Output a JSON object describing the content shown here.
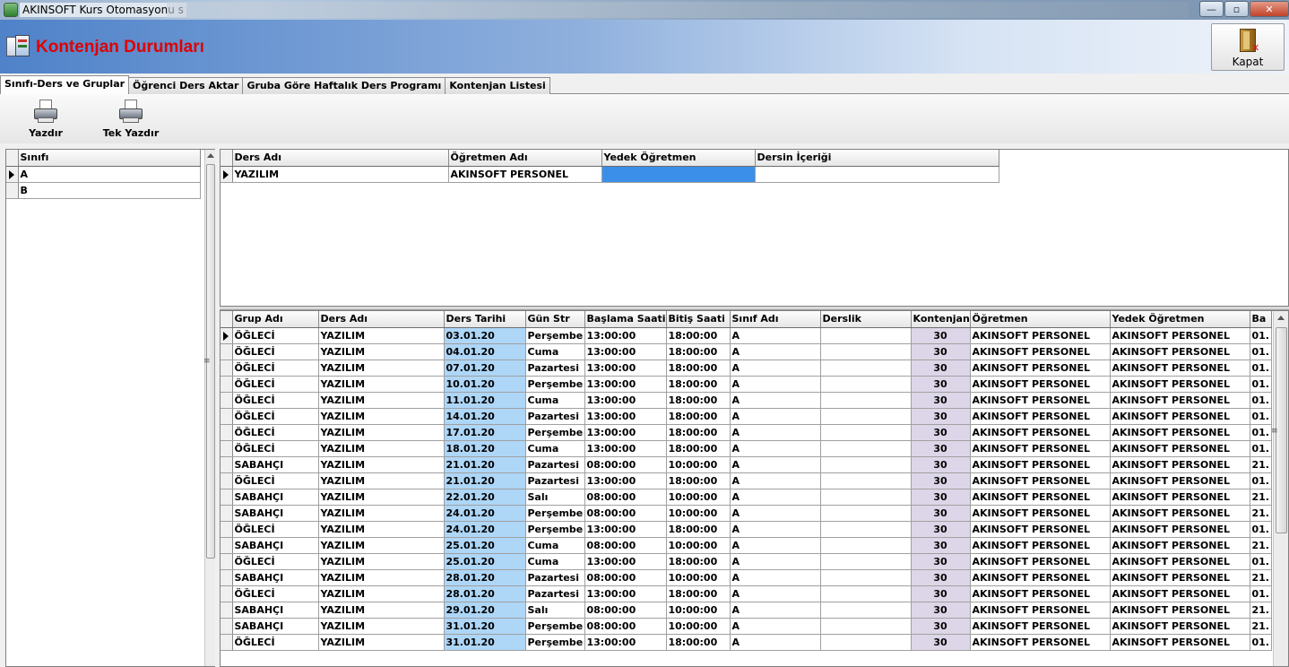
{
  "window": {
    "title": "AKINSOFT Kurs Otomasyonu s",
    "buttons": {
      "minimize": "—",
      "maximize": "▫",
      "close": "✕"
    }
  },
  "header": {
    "title": "Kontenjan Durumları",
    "close_label": "Kapat"
  },
  "tabs": [
    {
      "label": "Sınıfı-Ders ve Gruplar",
      "active": true
    },
    {
      "label": "Öğrenci Ders Aktar",
      "active": false
    },
    {
      "label": "Gruba Göre Haftalık Ders Programı",
      "active": false
    },
    {
      "label": "Kontenjan Listesi",
      "active": false
    }
  ],
  "toolbar": {
    "print_label": "Yazdır",
    "single_print_label": "Tek Yazdır"
  },
  "class_grid": {
    "header": "Sınıfı",
    "rows": [
      "A",
      "B"
    ]
  },
  "course_grid": {
    "headers": [
      "Ders Adı",
      "Öğretmen Adı",
      "Yedek Öğretmen",
      "Dersin İçeriği"
    ],
    "rows": [
      {
        "ders": "YAZILIM",
        "ogretmen": "AKINSOFT PERSONEL",
        "yedek": "",
        "icerik": ""
      }
    ]
  },
  "schedule_grid": {
    "headers": [
      "Grup Adı",
      "Ders Adı",
      "Ders Tarihi",
      "Gün Str",
      "Başlama Saati",
      "Bitiş Saati",
      "Sınıf Adı",
      "Derslik",
      "Kontenjan",
      "Öğretmen",
      "Yedek Öğretmen",
      "Ba"
    ],
    "rows": [
      [
        "ÖĞLECİ",
        "YAZILIM",
        "03.01.20",
        "Perşembe",
        "13:00:00",
        "18:00:00",
        "A",
        "",
        "30",
        "AKINSOFT PERSONEL",
        "AKINSOFT PERSONEL",
        "01."
      ],
      [
        "ÖĞLECİ",
        "YAZILIM",
        "04.01.20",
        "Cuma",
        "13:00:00",
        "18:00:00",
        "A",
        "",
        "30",
        "AKINSOFT PERSONEL",
        "AKINSOFT PERSONEL",
        "01."
      ],
      [
        "ÖĞLECİ",
        "YAZILIM",
        "07.01.20",
        "Pazartesi",
        "13:00:00",
        "18:00:00",
        "A",
        "",
        "30",
        "AKINSOFT PERSONEL",
        "AKINSOFT PERSONEL",
        "01."
      ],
      [
        "ÖĞLECİ",
        "YAZILIM",
        "10.01.20",
        "Perşembe",
        "13:00:00",
        "18:00:00",
        "A",
        "",
        "30",
        "AKINSOFT PERSONEL",
        "AKINSOFT PERSONEL",
        "01."
      ],
      [
        "ÖĞLECİ",
        "YAZILIM",
        "11.01.20",
        "Cuma",
        "13:00:00",
        "18:00:00",
        "A",
        "",
        "30",
        "AKINSOFT PERSONEL",
        "AKINSOFT PERSONEL",
        "01."
      ],
      [
        "ÖĞLECİ",
        "YAZILIM",
        "14.01.20",
        "Pazartesi",
        "13:00:00",
        "18:00:00",
        "A",
        "",
        "30",
        "AKINSOFT PERSONEL",
        "AKINSOFT PERSONEL",
        "01."
      ],
      [
        "ÖĞLECİ",
        "YAZILIM",
        "17.01.20",
        "Perşembe",
        "13:00:00",
        "18:00:00",
        "A",
        "",
        "30",
        "AKINSOFT PERSONEL",
        "AKINSOFT PERSONEL",
        "01."
      ],
      [
        "ÖĞLECİ",
        "YAZILIM",
        "18.01.20",
        "Cuma",
        "13:00:00",
        "18:00:00",
        "A",
        "",
        "30",
        "AKINSOFT PERSONEL",
        "AKINSOFT PERSONEL",
        "01."
      ],
      [
        "SABAHÇI",
        "YAZILIM",
        "21.01.20",
        "Pazartesi",
        "08:00:00",
        "10:00:00",
        "A",
        "",
        "30",
        "AKINSOFT PERSONEL",
        "AKINSOFT PERSONEL",
        "21."
      ],
      [
        "ÖĞLECİ",
        "YAZILIM",
        "21.01.20",
        "Pazartesi",
        "13:00:00",
        "18:00:00",
        "A",
        "",
        "30",
        "AKINSOFT PERSONEL",
        "AKINSOFT PERSONEL",
        "01."
      ],
      [
        "SABAHÇI",
        "YAZILIM",
        "22.01.20",
        "Salı",
        "08:00:00",
        "10:00:00",
        "A",
        "",
        "30",
        "AKINSOFT PERSONEL",
        "AKINSOFT PERSONEL",
        "21."
      ],
      [
        "SABAHÇI",
        "YAZILIM",
        "24.01.20",
        "Perşembe",
        "08:00:00",
        "10:00:00",
        "A",
        "",
        "30",
        "AKINSOFT PERSONEL",
        "AKINSOFT PERSONEL",
        "21."
      ],
      [
        "ÖĞLECİ",
        "YAZILIM",
        "24.01.20",
        "Perşembe",
        "13:00:00",
        "18:00:00",
        "A",
        "",
        "30",
        "AKINSOFT PERSONEL",
        "AKINSOFT PERSONEL",
        "01."
      ],
      [
        "SABAHÇI",
        "YAZILIM",
        "25.01.20",
        "Cuma",
        "08:00:00",
        "10:00:00",
        "A",
        "",
        "30",
        "AKINSOFT PERSONEL",
        "AKINSOFT PERSONEL",
        "21."
      ],
      [
        "ÖĞLECİ",
        "YAZILIM",
        "25.01.20",
        "Cuma",
        "13:00:00",
        "18:00:00",
        "A",
        "",
        "30",
        "AKINSOFT PERSONEL",
        "AKINSOFT PERSONEL",
        "01."
      ],
      [
        "SABAHÇI",
        "YAZILIM",
        "28.01.20",
        "Pazartesi",
        "08:00:00",
        "10:00:00",
        "A",
        "",
        "30",
        "AKINSOFT PERSONEL",
        "AKINSOFT PERSONEL",
        "21."
      ],
      [
        "ÖĞLECİ",
        "YAZILIM",
        "28.01.20",
        "Pazartesi",
        "13:00:00",
        "18:00:00",
        "A",
        "",
        "30",
        "AKINSOFT PERSONEL",
        "AKINSOFT PERSONEL",
        "01."
      ],
      [
        "SABAHÇI",
        "YAZILIM",
        "29.01.20",
        "Salı",
        "08:00:00",
        "10:00:00",
        "A",
        "",
        "30",
        "AKINSOFT PERSONEL",
        "AKINSOFT PERSONEL",
        "21."
      ],
      [
        "SABAHÇI",
        "YAZILIM",
        "31.01.20",
        "Perşembe",
        "08:00:00",
        "10:00:00",
        "A",
        "",
        "30",
        "AKINSOFT PERSONEL",
        "AKINSOFT PERSONEL",
        "21."
      ],
      [
        "ÖĞLECİ",
        "YAZILIM",
        "31.01.20",
        "Perşembe",
        "13:00:00",
        "18:00:00",
        "A",
        "",
        "30",
        "AKINSOFT PERSONEL",
        "AKINSOFT PERSONEL",
        "01."
      ]
    ]
  }
}
